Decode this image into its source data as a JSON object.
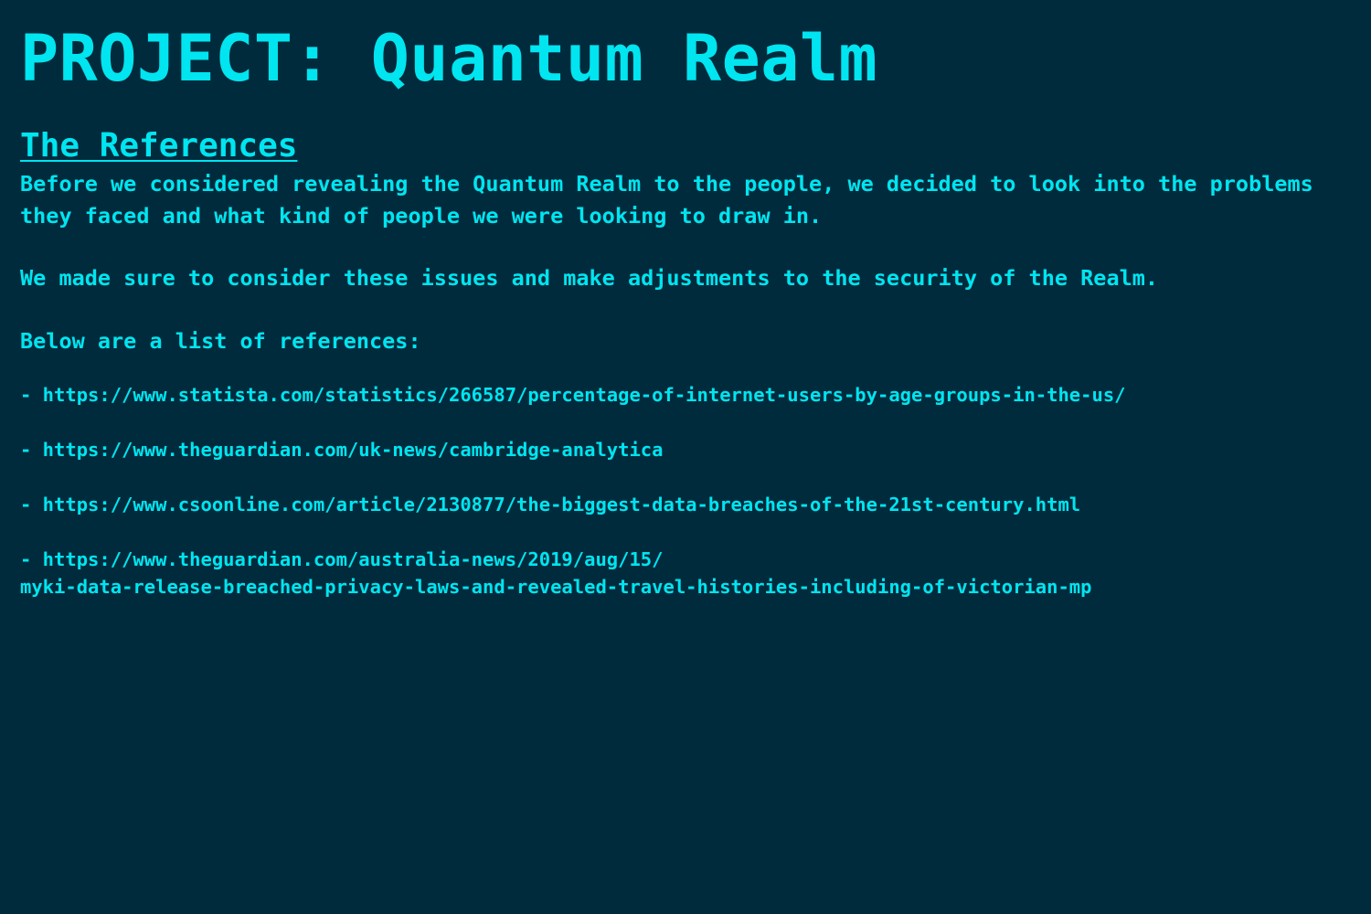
{
  "page": {
    "title": "PROJECT: Quantum Realm",
    "section_heading": "The References",
    "paragraphs": [
      "Before we considered revealing the Quantum Realm to the people, we decided to look into the problems they faced and what kind of people we were looking to draw in.",
      "We made sure to consider these issues and make adjustments to the security of the Realm.",
      "Below are a list of references:"
    ],
    "references": [
      {
        "line1": "- https://www.statista.com/statistics/266587/percentage-of-internet-users-by-age-groups-in-the-us/",
        "line2": ""
      },
      {
        "line1": "- https://www.theguardian.com/uk-news/cambridge-analytica",
        "line2": ""
      },
      {
        "line1": "- https://www.csoonline.com/article/2130877/the-biggest-data-breaches-of-the-21st-century.html",
        "line2": ""
      },
      {
        "line1": "- https://www.theguardian.com/australia-news/2019/aug/15/",
        "line2": "myki-data-release-breached-privacy-laws-and-revealed-travel-histories-including-of-victorian-mp"
      }
    ]
  },
  "colors": {
    "background": "#002b3d",
    "text": "#00e5f0"
  }
}
